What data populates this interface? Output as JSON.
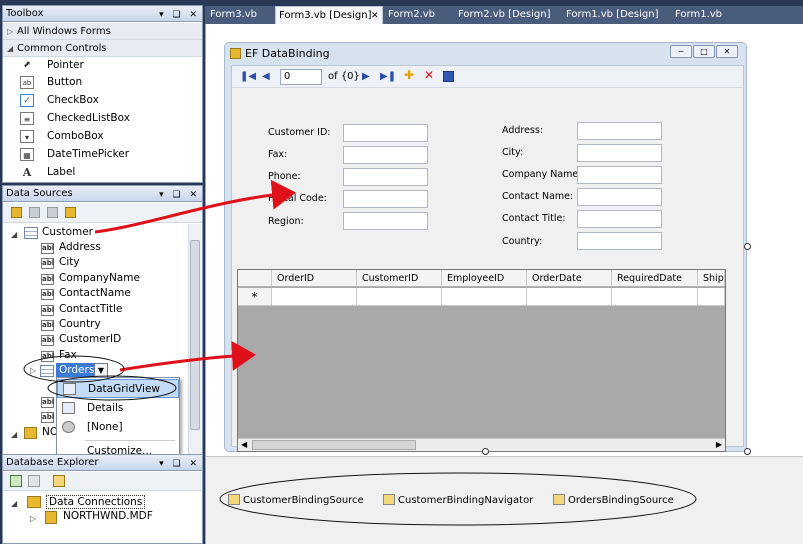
{
  "toolbox": {
    "title": "Toolbox",
    "controls": "▾ ❑ ✕",
    "all_forms": "All Windows Forms",
    "common_controls": "Common Controls",
    "items": [
      "Pointer",
      "Button",
      "CheckBox",
      "CheckedListBox",
      "ComboBox",
      "DateTimePicker",
      "Label"
    ]
  },
  "data_sources": {
    "title": "Data Sources",
    "controls": "▾ ❑ ✕",
    "root": "Customer",
    "fields": [
      "Address",
      "City",
      "CompanyName",
      "ContactName",
      "ContactTitle",
      "Country",
      "CustomerID",
      "Fax"
    ],
    "selected": "Orders",
    "partial_node": "NO"
  },
  "dropdown": {
    "items": [
      "DataGridView",
      "Details",
      "[None]",
      "Customize..."
    ],
    "selected": "DataGridView"
  },
  "db_explorer": {
    "title": "Database Explorer",
    "controls": "▾ ❑ ✕",
    "root": "Data Connections",
    "child": "NORTHWND.MDF"
  },
  "tabs": [
    "Form3.vb",
    "Form3.vb [Design]",
    "Form2.vb",
    "Form2.vb [Design]",
    "Form1.vb [Design]",
    "Form1.vb"
  ],
  "active_tab": "Form3.vb [Design]",
  "form": {
    "title": "EF DataBinding",
    "position_value": "0",
    "count_text": "of {0}",
    "left_labels": [
      "Customer ID:",
      "Fax:",
      "Phone:",
      "Postal Code:",
      "Region:"
    ],
    "right_labels": [
      "Address:",
      "City:",
      "Company Name:",
      "Contact Name:",
      "Contact Title:",
      "Country:"
    ]
  },
  "grid": {
    "columns": [
      "OrderID",
      "CustomerID",
      "EmployeeID",
      "OrderDate",
      "RequiredDate",
      "Shipp"
    ],
    "new_row_marker": "*"
  },
  "tray": [
    "CustomerBindingSource",
    "CustomerBindingNavigator",
    "OrdersBindingSource"
  ],
  "accent_colors": {
    "arrow": "#e0101a",
    "selection": "#3b7ad9",
    "tab_strip": "#4a5c7c"
  }
}
